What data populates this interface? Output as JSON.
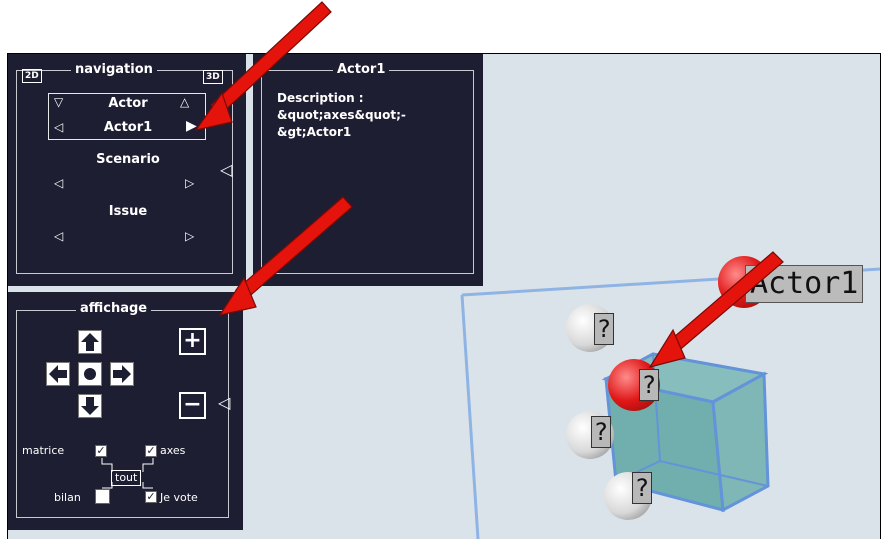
{
  "navigation": {
    "title": "navigation",
    "tag_2d": "2D",
    "tag_3d": "3D",
    "actor_label": "Actor",
    "actor_value": "Actor1",
    "scenario_label": "Scenario",
    "issue_label": "Issue"
  },
  "info_panel": {
    "title": "Actor1",
    "description_lines": [
      "Description :",
      "&quot;axes&quot;-",
      "&gt;Actor1"
    ]
  },
  "affichage": {
    "title": "affichage",
    "plus": "+",
    "minus": "−",
    "checkboxes": {
      "matrice": {
        "label": "matrice",
        "checked": true
      },
      "axes": {
        "label": "axes",
        "checked": true
      },
      "bilan": {
        "label": "bilan",
        "checked": false
      },
      "je_vote": {
        "label": "Je vote",
        "checked": true
      }
    },
    "tout_label": "tout"
  },
  "scene": {
    "actor_label": "Actor1",
    "question_mark": "?"
  },
  "colors": {
    "panel_bg": "#1d1e32",
    "scene_bg": "#dbe3ea",
    "cube_fill": "#6aa9a9",
    "arrow": "#e4130c",
    "red_ball": "#e01818",
    "white_ball": "#dcdcdc"
  }
}
